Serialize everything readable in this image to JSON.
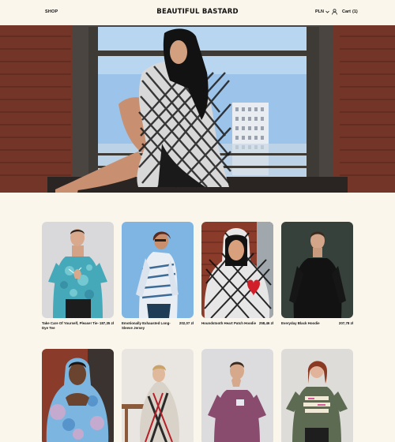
{
  "header": {
    "nav_shop": "SHOP",
    "logo": "BEAUTIFUL BASTARD",
    "currency": "PLN",
    "cart_label": "Cart",
    "cart_count": "(1)"
  },
  "products": [
    {
      "title": "Take Care Of Yourself, Please! Tie-Dye Tee",
      "price": "187,35 zł"
    },
    {
      "title": "Emotionally Exhausted Long-Sleeve Jersey",
      "price": "202,07 zł"
    },
    {
      "title": "Houndstooth Heart Patch Hoodie",
      "price": "258,46 zł"
    },
    {
      "title": "Everyday Black Hoodie",
      "price": "207,78 zł"
    }
  ],
  "colors": {
    "background": "#fbf6ec",
    "brick": "#8a3b2a",
    "sky": "#8ab8e6"
  }
}
